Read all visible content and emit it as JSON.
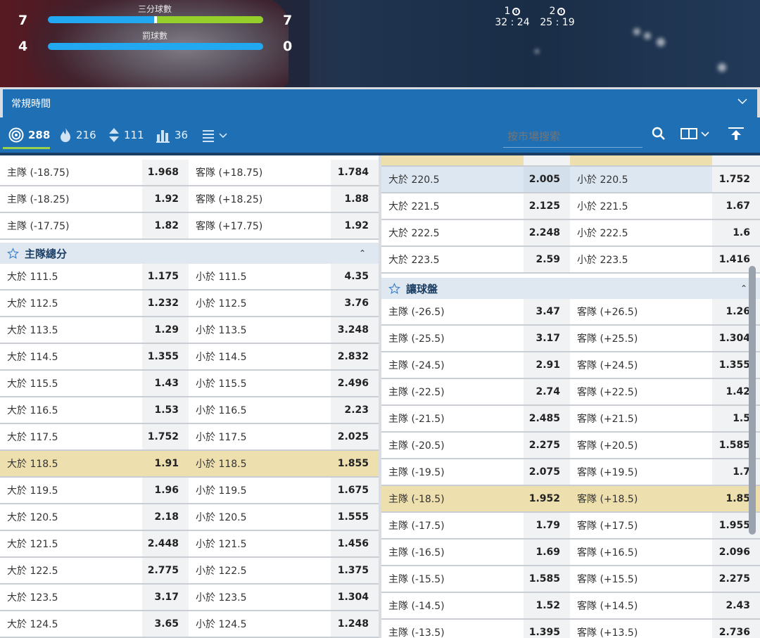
{
  "scoreboard": {
    "three_pt": {
      "label": "三分球數",
      "home": "7",
      "away": "7",
      "home_share": 0.5
    },
    "free_throw": {
      "label": "罰球數",
      "home": "4",
      "away": "0",
      "home_share": 1.0
    },
    "quarters": [
      {
        "label": "1",
        "time": "32 : 24"
      },
      {
        "label": "2",
        "time": "25 : 19"
      }
    ]
  },
  "period": {
    "label": "常規時間"
  },
  "tabs": [
    {
      "icon": "target-icon",
      "count": "288"
    },
    {
      "icon": "fire-icon",
      "count": "216"
    },
    {
      "icon": "updown-icon",
      "count": "111"
    },
    {
      "icon": "stats-icon",
      "count": "36"
    },
    {
      "icon": "list-menu-icon",
      "count": ""
    }
  ],
  "search": {
    "placeholder": "按市場搜索"
  },
  "left": {
    "top_rows": [
      {
        "a": "主隊 (-18.75)",
        "ao": "1.968",
        "b": "客隊 (+18.75)",
        "bo": "1.784"
      },
      {
        "a": "主隊 (-18.25)",
        "ao": "1.92",
        "b": "客隊 (+18.25)",
        "bo": "1.88"
      },
      {
        "a": "主隊 (-17.75)",
        "ao": "1.82",
        "b": "客隊 (+17.75)",
        "bo": "1.92"
      }
    ],
    "section_title": "主隊總分",
    "rows": [
      {
        "a": "大於 111.5",
        "ao": "1.175",
        "b": "小於 111.5",
        "bo": "4.35"
      },
      {
        "a": "大於 112.5",
        "ao": "1.232",
        "b": "小於 112.5",
        "bo": "3.76"
      },
      {
        "a": "大於 113.5",
        "ao": "1.29",
        "b": "小於 113.5",
        "bo": "3.248"
      },
      {
        "a": "大於 114.5",
        "ao": "1.355",
        "b": "小於 114.5",
        "bo": "2.832"
      },
      {
        "a": "大於 115.5",
        "ao": "1.43",
        "b": "小於 115.5",
        "bo": "2.496"
      },
      {
        "a": "大於 116.5",
        "ao": "1.53",
        "b": "小於 116.5",
        "bo": "2.23"
      },
      {
        "a": "大於 117.5",
        "ao": "1.752",
        "b": "小於 117.5",
        "bo": "2.025"
      },
      {
        "a": "大於 118.5",
        "ao": "1.91",
        "b": "小於 118.5",
        "bo": "1.855",
        "hl": true
      },
      {
        "a": "大於 119.5",
        "ao": "1.96",
        "b": "小於 119.5",
        "bo": "1.675"
      },
      {
        "a": "大於 120.5",
        "ao": "2.18",
        "b": "小於 120.5",
        "bo": "1.555"
      },
      {
        "a": "大於 121.5",
        "ao": "2.448",
        "b": "小於 121.5",
        "bo": "1.456"
      },
      {
        "a": "大於 122.5",
        "ao": "2.775",
        "b": "小於 122.5",
        "bo": "1.375"
      },
      {
        "a": "大於 123.5",
        "ao": "3.17",
        "b": "小於 123.5",
        "bo": "1.304"
      },
      {
        "a": "大於 124.5",
        "ao": "3.65",
        "b": "小於 124.5",
        "bo": "1.248"
      }
    ]
  },
  "right": {
    "top_rows": [
      {
        "a": "大於 220.5",
        "ao": "2.005",
        "b": "小於 220.5",
        "bo": "1.752",
        "sel": true
      },
      {
        "a": "大於 221.5",
        "ao": "2.125",
        "b": "小於 221.5",
        "bo": "1.67"
      },
      {
        "a": "大於 222.5",
        "ao": "2.248",
        "b": "小於 222.5",
        "bo": "1.6"
      },
      {
        "a": "大於 223.5",
        "ao": "2.59",
        "b": "小於 223.5",
        "bo": "1.416"
      }
    ],
    "section_title": "讓球盤",
    "rows": [
      {
        "a": "主隊 (-26.5)",
        "ao": "3.47",
        "b": "客隊 (+26.5)",
        "bo": "1.26"
      },
      {
        "a": "主隊 (-25.5)",
        "ao": "3.17",
        "b": "客隊 (+25.5)",
        "bo": "1.304"
      },
      {
        "a": "主隊 (-24.5)",
        "ao": "2.91",
        "b": "客隊 (+24.5)",
        "bo": "1.355"
      },
      {
        "a": "主隊 (-22.5)",
        "ao": "2.74",
        "b": "客隊 (+22.5)",
        "bo": "1.42"
      },
      {
        "a": "主隊 (-21.5)",
        "ao": "2.485",
        "b": "客隊 (+21.5)",
        "bo": "1.5"
      },
      {
        "a": "主隊 (-20.5)",
        "ao": "2.275",
        "b": "客隊 (+20.5)",
        "bo": "1.585"
      },
      {
        "a": "主隊 (-19.5)",
        "ao": "2.075",
        "b": "客隊 (+19.5)",
        "bo": "1.7"
      },
      {
        "a": "主隊 (-18.5)",
        "ao": "1.952",
        "b": "客隊 (+18.5)",
        "bo": "1.85",
        "hl": true
      },
      {
        "a": "主隊 (-17.5)",
        "ao": "1.79",
        "b": "客隊 (+17.5)",
        "bo": "1.955"
      },
      {
        "a": "主隊 (-16.5)",
        "ao": "1.69",
        "b": "客隊 (+16.5)",
        "bo": "2.096"
      },
      {
        "a": "主隊 (-15.5)",
        "ao": "1.585",
        "b": "客隊 (+15.5)",
        "bo": "2.275"
      },
      {
        "a": "主隊 (-14.5)",
        "ao": "1.52",
        "b": "客隊 (+14.5)",
        "bo": "2.43"
      },
      {
        "a": "主隊 (-13.5)",
        "ao": "1.395",
        "b": "客隊 (+13.5)",
        "bo": "2.736"
      }
    ]
  },
  "colors": {
    "accent_blue": "#1e6fb3",
    "highlight": "#eddfae",
    "bar_blue": "#22a8f0",
    "bar_green": "#94cf2c"
  }
}
